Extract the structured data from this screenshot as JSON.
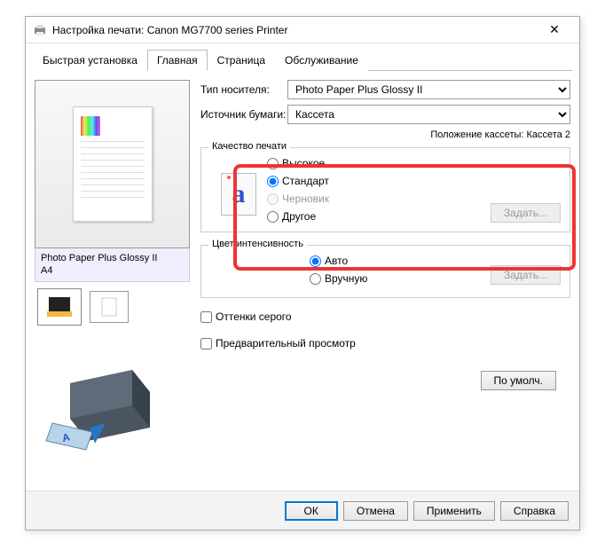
{
  "window": {
    "title": "Настройка печати: Canon MG7700 series Printer"
  },
  "tabs": {
    "quick": "Быстрая установка",
    "main": "Главная",
    "page": "Страница",
    "service": "Обслуживание"
  },
  "media": {
    "type_label": "Тип носителя:",
    "type_value": "Photo Paper Plus Glossy II",
    "source_label": "Источник бумаги:",
    "source_value": "Кассета",
    "cassette_pos": "Положение кассеты: Кассета 2"
  },
  "preview": {
    "label": "Photo Paper Plus Glossy II\nA4"
  },
  "quality": {
    "legend": "Качество печати",
    "high": "Высокое",
    "standard": "Стандарт",
    "draft": "Черновик",
    "other": "Другое",
    "set_btn": "Задать..."
  },
  "color": {
    "legend": "Цвет/интенсивность",
    "auto": "Авто",
    "manual": "Вручную",
    "set_btn": "Задать..."
  },
  "checks": {
    "grayscale": "Оттенки серого",
    "preview": "Предварительный просмотр"
  },
  "defaults_btn": "По умолч.",
  "buttons": {
    "ok": "ОК",
    "cancel": "Отмена",
    "apply": "Применить",
    "help": "Справка"
  }
}
